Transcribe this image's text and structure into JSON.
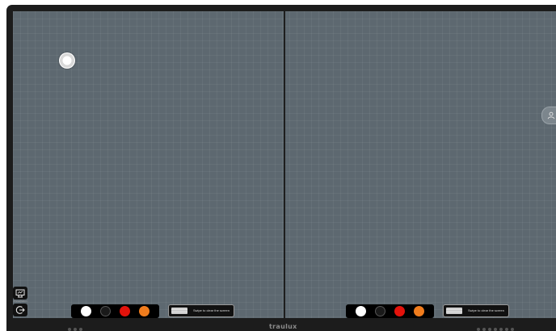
{
  "app": {
    "brand": "traulux"
  },
  "left_toolbar": {
    "presentation_label": "Presentation",
    "presentation_icon": "monitor-icon",
    "exit_icon": "exit-icon"
  },
  "panels": [
    {
      "colors": [
        "#ffffff",
        "#1a1a1a",
        "#e3120b",
        "#f07c1d"
      ],
      "clear_label": "Swipe to clear the screen"
    },
    {
      "colors": [
        "#ffffff",
        "#1a1a1a",
        "#e3120b",
        "#f07c1d"
      ],
      "clear_label": "Swipe to clear the screen"
    }
  ],
  "side": {
    "user_icon": "user-icon"
  },
  "colors": {
    "canvas": "#5d6870",
    "bezel": "#1c1c1c"
  }
}
